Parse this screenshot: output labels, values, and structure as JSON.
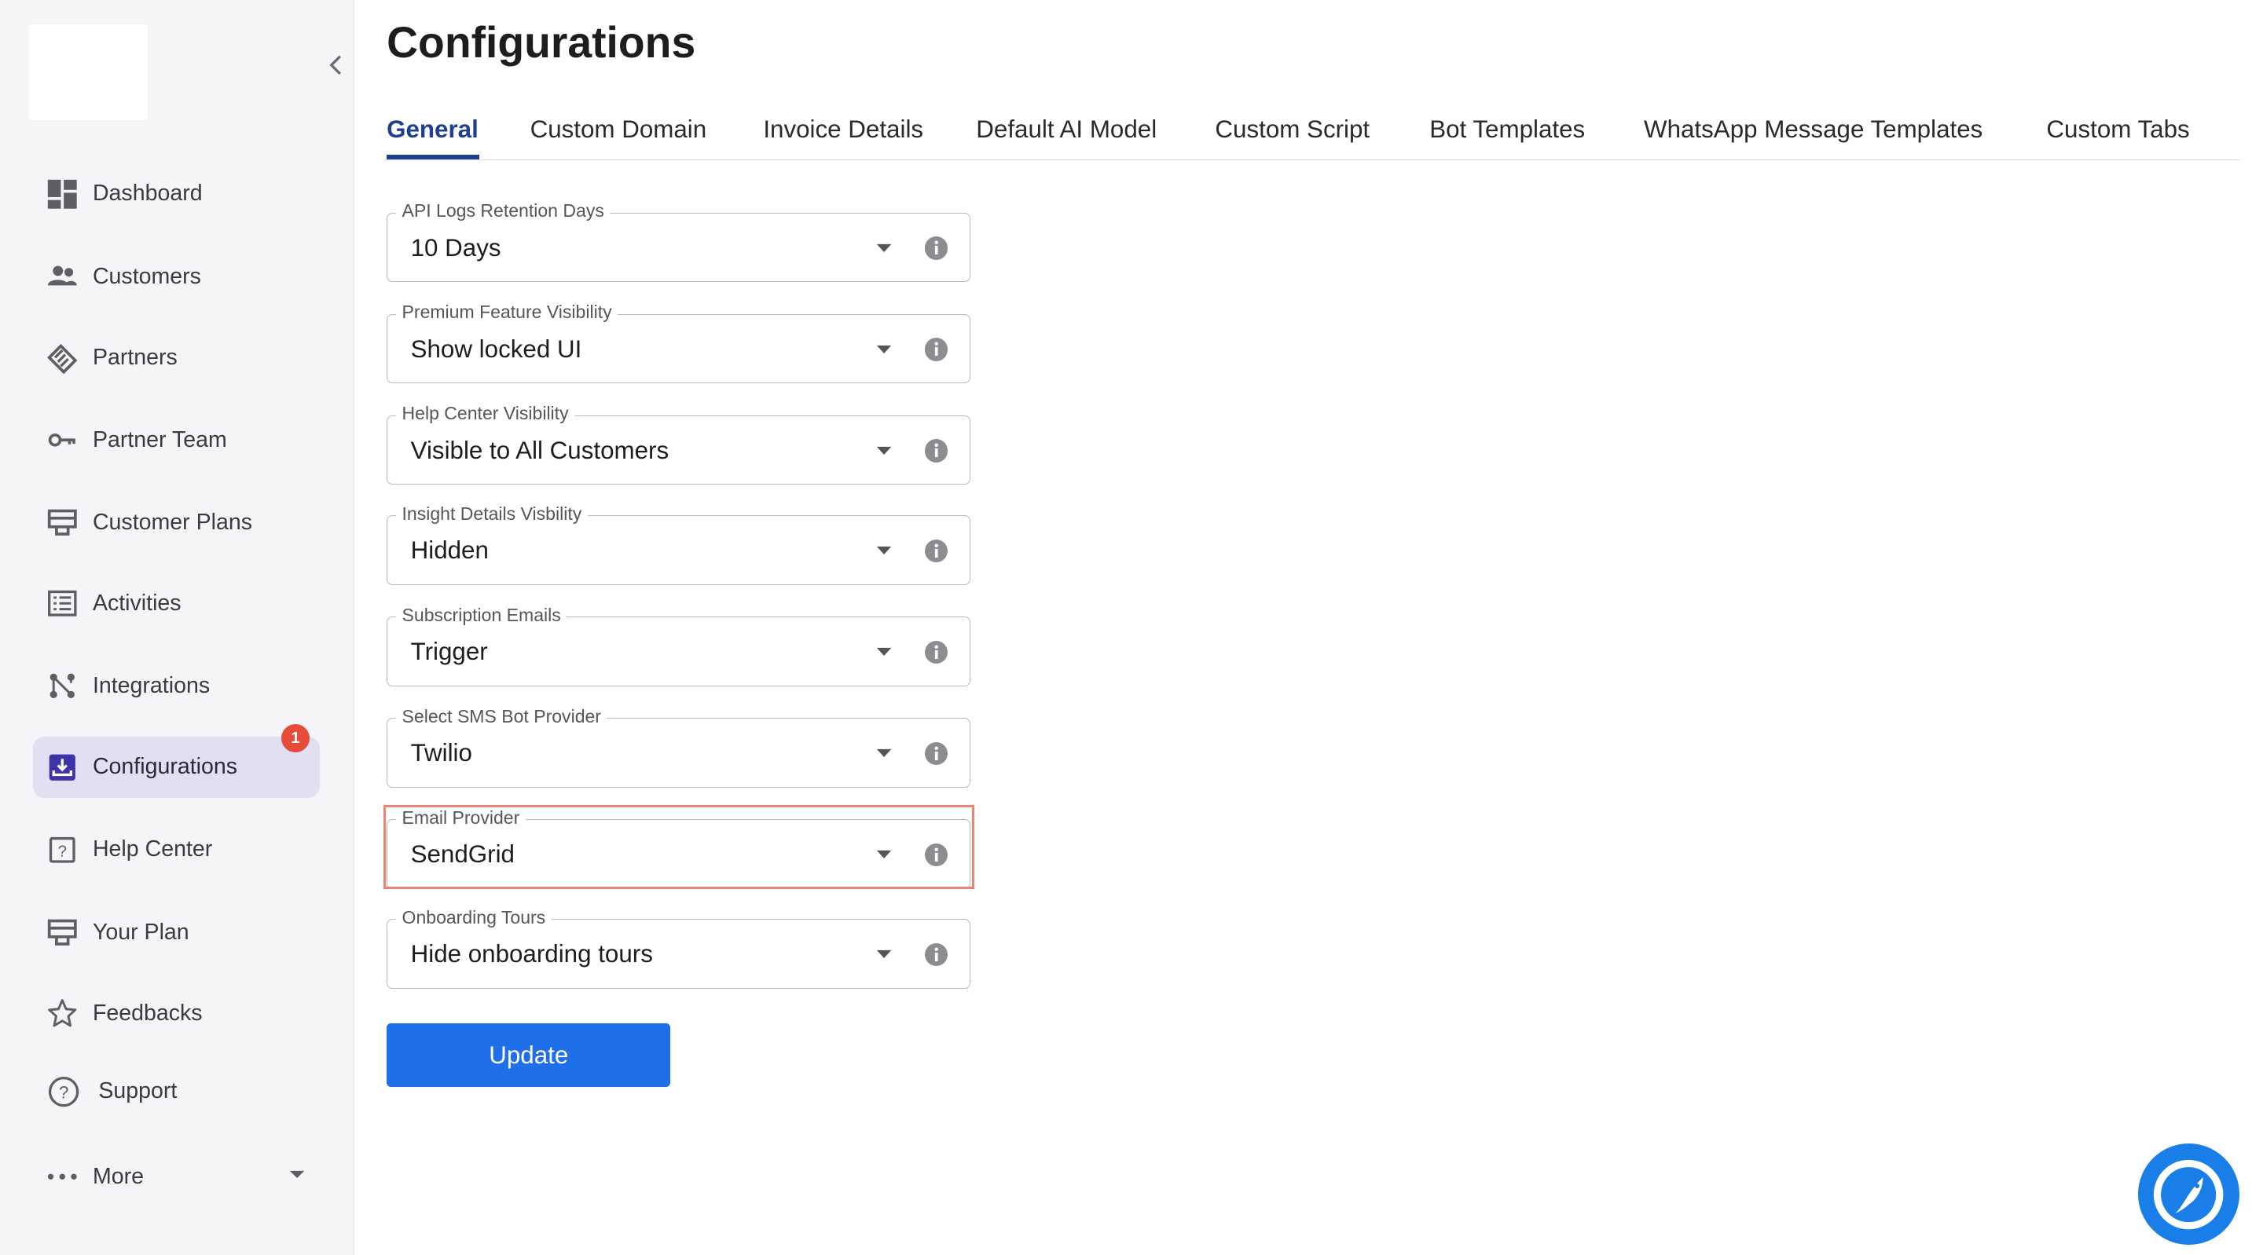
{
  "sidebar": {
    "items": [
      {
        "label": "Dashboard",
        "icon": "dashboard-icon"
      },
      {
        "label": "Customers",
        "icon": "customers-icon"
      },
      {
        "label": "Partners",
        "icon": "partners-icon"
      },
      {
        "label": "Partner Team",
        "icon": "key-icon"
      },
      {
        "label": "Customer Plans",
        "icon": "plans-icon"
      },
      {
        "label": "Activities",
        "icon": "activities-icon"
      },
      {
        "label": "Integrations",
        "icon": "integrations-icon"
      },
      {
        "label": "Configurations",
        "icon": "configurations-icon",
        "active": true,
        "badge": "1"
      },
      {
        "label": "Help Center",
        "icon": "help-center-icon"
      },
      {
        "label": "Your Plan",
        "icon": "plan-icon"
      },
      {
        "label": "Feedbacks",
        "icon": "star-icon"
      },
      {
        "label": "Support",
        "icon": "support-icon"
      },
      {
        "label": "More",
        "icon": "more-icon"
      }
    ]
  },
  "page": {
    "title": "Configurations"
  },
  "tabs": [
    {
      "label": "General",
      "active": true
    },
    {
      "label": "Custom Domain"
    },
    {
      "label": "Invoice Details"
    },
    {
      "label": "Default AI Model"
    },
    {
      "label": "Custom Script"
    },
    {
      "label": "Bot Templates"
    },
    {
      "label": "WhatsApp Message Templates"
    },
    {
      "label": "Custom Tabs"
    }
  ],
  "fields": [
    {
      "label": "API Logs Retention Days",
      "value": "10 Days"
    },
    {
      "label": "Premium Feature Visibility",
      "value": "Show locked UI"
    },
    {
      "label": "Help Center Visibility",
      "value": "Visible to All Customers"
    },
    {
      "label": "Insight Details Visbility",
      "value": "Hidden"
    },
    {
      "label": "Subscription Emails",
      "value": "Trigger"
    },
    {
      "label": "Select SMS Bot Provider",
      "value": "Twilio"
    },
    {
      "label": "Email Provider",
      "value": "SendGrid",
      "highlighted": true
    },
    {
      "label": "Onboarding Tours",
      "value": "Hide onboarding tours"
    }
  ],
  "actions": {
    "update_label": "Update"
  },
  "colors": {
    "accent": "#1f6fe9",
    "active_tab": "#1f3f8f",
    "active_nav_bg": "#e3dff3",
    "badge": "#e64b3c",
    "highlight": "#ec8577",
    "chat_button": "#1a7ee8"
  }
}
